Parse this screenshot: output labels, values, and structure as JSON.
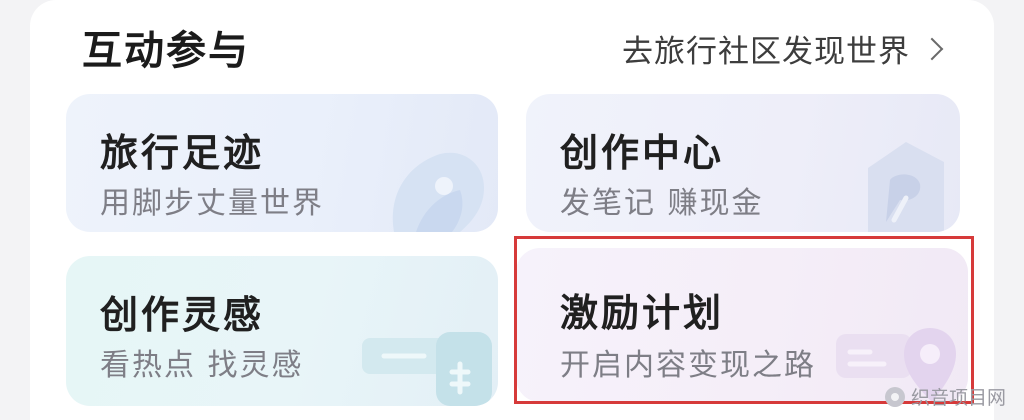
{
  "section": {
    "title": "互动参与",
    "more_link": "去旅行社区发现世界",
    "more_icon": "chevron-right-icon"
  },
  "cards": [
    {
      "title": "旅行足迹",
      "subtitle": "用脚步丈量世界",
      "icon": "footprint-pin-icon"
    },
    {
      "title": "创作中心",
      "subtitle": "发笔记 赚现金",
      "icon": "pen-nib-icon"
    },
    {
      "title": "创作灵感",
      "subtitle": "看热点 找灵感",
      "icon": "community-icon"
    },
    {
      "title": "激励计划",
      "subtitle": "开启内容变现之路",
      "icon": "coin-location-icon"
    }
  ],
  "highlight": {
    "target": "激励计划",
    "color": "#d63a3a"
  },
  "watermark": {
    "text": "织音项目网"
  },
  "colors": {
    "card_blue": "#eaf0fb",
    "card_teal": "#e6f6f6",
    "card_pink": "#f5eef8",
    "subtitle_gray": "#7e7e86"
  }
}
